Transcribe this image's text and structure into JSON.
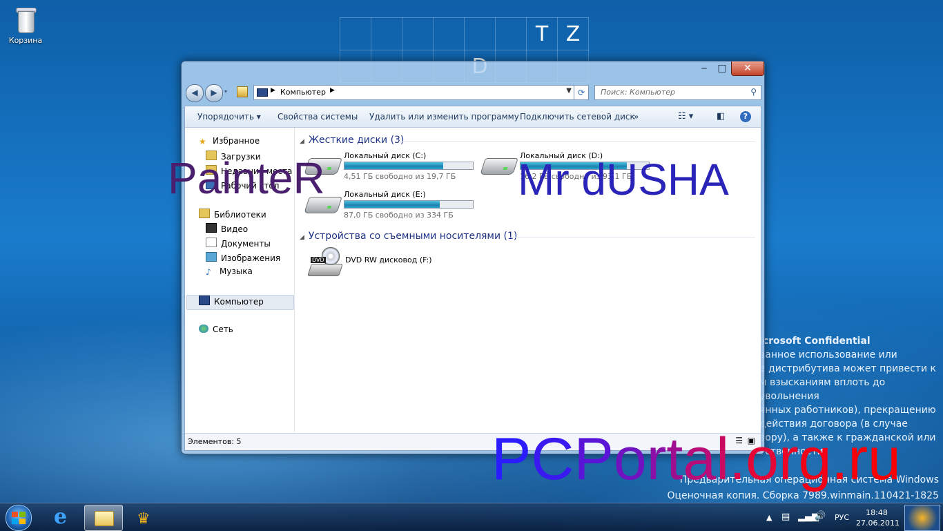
{
  "desktop": {
    "recycle_bin_label": "Корзина",
    "tiles_letters": [
      "T",
      "Z",
      "D"
    ],
    "confidential_title": "icrosoft Confidential",
    "confidential_lines": [
      "ванное использование или",
      "е дистрибутива может привести к",
      "м взысканиям вплоть до увольнения",
      "янных работников), прекращению",
      "действия договора (в случае",
      "вору), а также к гражданской или",
      "тственности."
    ],
    "os_edition": "Предварительная операционная система Windows",
    "build_info": "Оценочная копия. Сборка 7989.winmain.110421-1825"
  },
  "overlays": {
    "left": "PainteR",
    "left_color": "#4a1f6e",
    "right": "Mr dUSHA",
    "right_color_start": "#5a1a2a",
    "right_color_end": "#1a28c8",
    "site": "PCPortal.org.ru"
  },
  "window": {
    "controls": {
      "minimize": "‒",
      "maximize": "□",
      "close": "✕"
    },
    "address": {
      "crumb": "Компьютер"
    },
    "search": {
      "placeholder": "Поиск: Компьютер"
    },
    "toolbar": {
      "organize": "Упорядочить ▾",
      "system_properties": "Свойства системы",
      "uninstall": "Удалить или изменить программу",
      "map_drive": "Подключить сетевой диск",
      "more": "»",
      "help": "?"
    },
    "nav": {
      "favorites": "Избранное",
      "downloads": "Загрузки",
      "recent": "Недавние места",
      "desktop": "Рабочий стол",
      "libraries": "Библиотеки",
      "video": "Видео",
      "documents": "Документы",
      "pictures": "Изображения",
      "music": "Музыка",
      "computer": "Компьютер",
      "network": "Сеть"
    },
    "groups": {
      "hard_disks": "Жесткие диски (3)",
      "removable": "Устройства со съемными носителями (1)"
    },
    "drives": [
      {
        "name": "Локальный диск (C:)",
        "free": "4,51 ГБ свободно из 19,7 ГБ",
        "used_fraction": 0.77
      },
      {
        "name": "Локальный диск (D:)",
        "free": "16,2 ГБ свободно из 93,1 ГБ",
        "used_fraction": 0.83
      },
      {
        "name": "Локальный диск (E:)",
        "free": "87,0 ГБ свободно из 334 ГБ",
        "used_fraction": 0.74
      }
    ],
    "dvd": {
      "name": "DVD RW дисковод (F:)",
      "badge": "DVD"
    },
    "status": "Элементов: 5"
  },
  "taskbar": {
    "language": "РУС",
    "time": "18:48",
    "date": "27.06.2011",
    "tray_arrow": "▲"
  }
}
